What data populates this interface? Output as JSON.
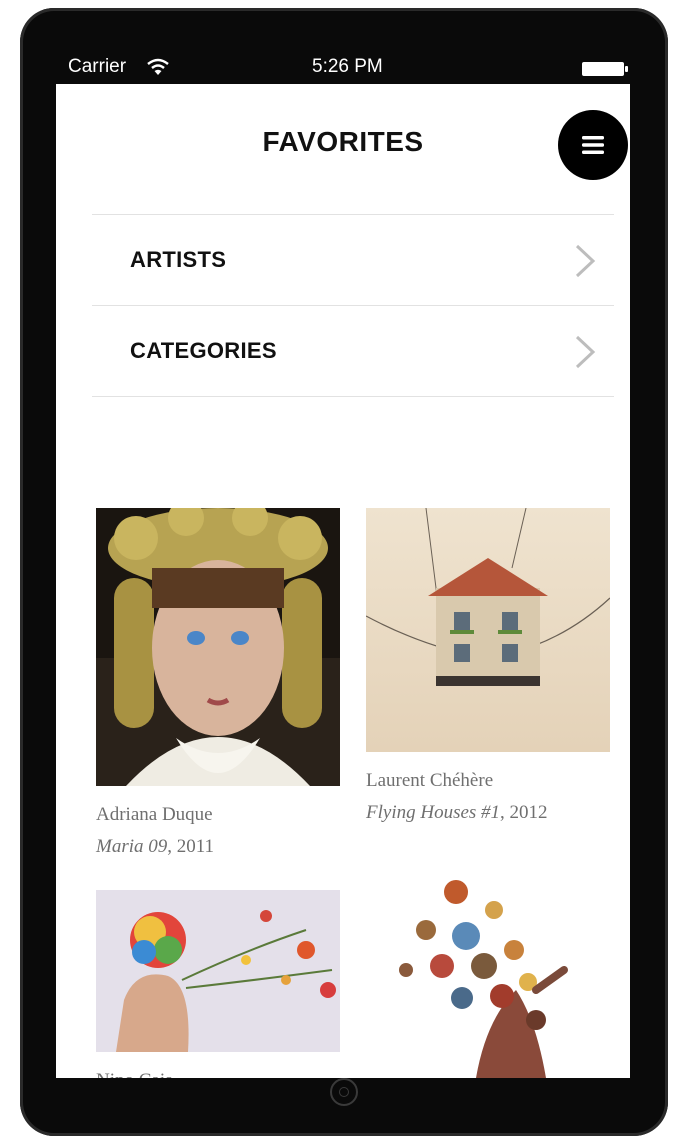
{
  "status_bar": {
    "carrier": "Carrier",
    "time": "5:26 PM"
  },
  "header": {
    "title": "FAVORITES",
    "menu_icon": "hamburger-icon"
  },
  "list": {
    "items": [
      {
        "label": "ARTISTS",
        "icon": "chevron-right-icon"
      },
      {
        "label": "CATEGORIES",
        "icon": "chevron-right-icon"
      }
    ]
  },
  "favorites": [
    {
      "artist": "Adriana Duque",
      "work": "Maria 09",
      "year": ", 2011"
    },
    {
      "artist": "Laurent Chéhère",
      "work": "Flying Houses #1",
      "year": ", 2012"
    },
    {
      "artist": "Nino Cais",
      "work": "",
      "year": ""
    },
    {
      "artist": "",
      "work": "",
      "year": ""
    }
  ],
  "colors": {
    "frame": "#0a0a0a",
    "text": "#111111",
    "caption": "#6f6f6f",
    "divider": "#e2e2e2"
  }
}
